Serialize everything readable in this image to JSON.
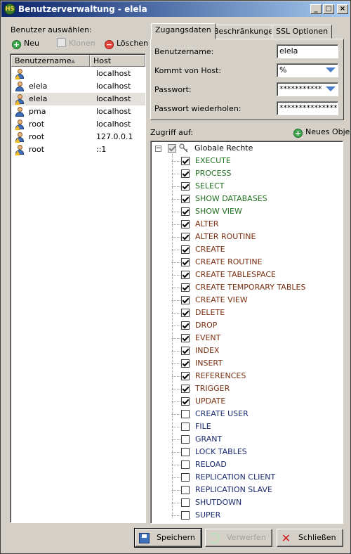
{
  "window": {
    "title": "Benutzerverwaltung - elela",
    "app_icon_text": "HS"
  },
  "left": {
    "select_label": "Benutzer auswählen:",
    "toolbar": {
      "new_label": "Neu",
      "clone_label": "Klonen",
      "delete_label": "Löschen"
    },
    "columns": {
      "username": "Benutzername",
      "host": "Host",
      "sort_indicator": "▲"
    },
    "users": [
      {
        "name": "",
        "host": "localhost",
        "icon": "warning-user-icon"
      },
      {
        "name": "elela",
        "host": "localhost",
        "icon": "user-icon"
      },
      {
        "name": "elela",
        "host": "localhost",
        "icon": "warning-user-icon",
        "selected": true
      },
      {
        "name": "pma",
        "host": "localhost",
        "icon": "user-icon"
      },
      {
        "name": "root",
        "host": "localhost",
        "icon": "warning-user-icon"
      },
      {
        "name": "root",
        "host": "127.0.0.1",
        "icon": "warning-user-icon"
      },
      {
        "name": "root",
        "host": "::1",
        "icon": "warning-user-icon"
      }
    ]
  },
  "tabs": [
    {
      "label": "Zugangsdaten",
      "active": true
    },
    {
      "label": "Beschränkungen",
      "active": false
    },
    {
      "label": "SSL Optionen",
      "active": false
    }
  ],
  "credentials": {
    "username_label": "Benutzername:",
    "username_value": "elela",
    "host_label": "Kommt von Host:",
    "host_value": "%",
    "password_label": "Passwort:",
    "password_value": "***********",
    "password_repeat_label": "Passwort wiederholen:",
    "password_repeat_value": "***************"
  },
  "access": {
    "label": "Zugriff auf:",
    "new_object_label": "Neues Obje",
    "root_label": "Globale Rechte",
    "privileges": [
      {
        "name": "EXECUTE",
        "checked": true,
        "color": "#207020"
      },
      {
        "name": "PROCESS",
        "checked": true,
        "color": "#207020"
      },
      {
        "name": "SELECT",
        "checked": true,
        "color": "#207020"
      },
      {
        "name": "SHOW DATABASES",
        "checked": true,
        "color": "#207020"
      },
      {
        "name": "SHOW VIEW",
        "checked": true,
        "color": "#207020"
      },
      {
        "name": "ALTER",
        "checked": true,
        "color": "#7a2e10"
      },
      {
        "name": "ALTER ROUTINE",
        "checked": true,
        "color": "#7a2e10"
      },
      {
        "name": "CREATE",
        "checked": true,
        "color": "#7a2e10"
      },
      {
        "name": "CREATE ROUTINE",
        "checked": true,
        "color": "#7a2e10"
      },
      {
        "name": "CREATE TABLESPACE",
        "checked": true,
        "color": "#7a2e10"
      },
      {
        "name": "CREATE TEMPORARY TABLES",
        "checked": true,
        "color": "#7a2e10"
      },
      {
        "name": "CREATE VIEW",
        "checked": true,
        "color": "#7a2e10"
      },
      {
        "name": "DELETE",
        "checked": true,
        "color": "#7a2e10"
      },
      {
        "name": "DROP",
        "checked": true,
        "color": "#7a2e10"
      },
      {
        "name": "EVENT",
        "checked": true,
        "color": "#7a2e10"
      },
      {
        "name": "INDEX",
        "checked": true,
        "color": "#7a2e10"
      },
      {
        "name": "INSERT",
        "checked": true,
        "color": "#7a2e10"
      },
      {
        "name": "REFERENCES",
        "checked": true,
        "color": "#7a2e10"
      },
      {
        "name": "TRIGGER",
        "checked": true,
        "color": "#7a2e10"
      },
      {
        "name": "UPDATE",
        "checked": true,
        "color": "#7a2e10"
      },
      {
        "name": "CREATE USER",
        "checked": false,
        "color": "#1a2a70"
      },
      {
        "name": "FILE",
        "checked": false,
        "color": "#1a2a70"
      },
      {
        "name": "GRANT",
        "checked": false,
        "color": "#1a2a70"
      },
      {
        "name": "LOCK TABLES",
        "checked": false,
        "color": "#1a2a70"
      },
      {
        "name": "RELOAD",
        "checked": false,
        "color": "#1a2a70"
      },
      {
        "name": "REPLICATION CLIENT",
        "checked": false,
        "color": "#1a2a70"
      },
      {
        "name": "REPLICATION SLAVE",
        "checked": false,
        "color": "#1a2a70"
      },
      {
        "name": "SHUTDOWN",
        "checked": false,
        "color": "#1a2a70"
      },
      {
        "name": "SUPER",
        "checked": false,
        "color": "#1a2a70"
      }
    ]
  },
  "buttons": {
    "save": "Speichern",
    "discard": "Verwerfen",
    "close": "Schließen"
  }
}
